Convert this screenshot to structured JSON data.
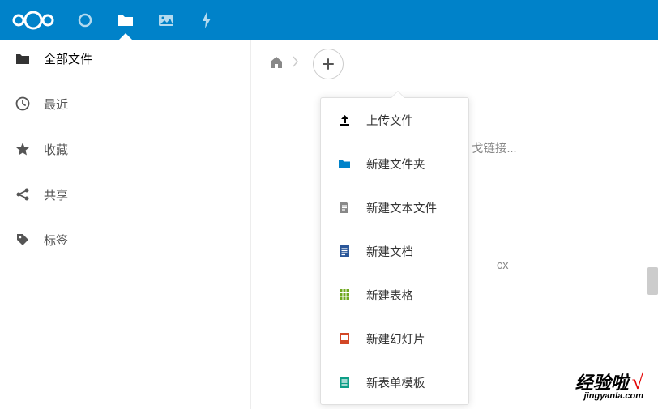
{
  "header": {
    "logo": "ooo",
    "navs": [
      {
        "name": "circle-icon"
      },
      {
        "name": "files-icon",
        "active": true
      },
      {
        "name": "gallery-icon"
      },
      {
        "name": "activity-icon"
      }
    ]
  },
  "sidebar": {
    "items": [
      {
        "icon": "folder-icon",
        "label": "全部文件",
        "active": true
      },
      {
        "icon": "clock-icon",
        "label": "最近"
      },
      {
        "icon": "star-icon",
        "label": "收藏"
      },
      {
        "icon": "share-icon",
        "label": "共享"
      },
      {
        "icon": "tag-icon",
        "label": "标签"
      }
    ]
  },
  "breadcrumb": {
    "home": "home-icon",
    "add": "+"
  },
  "dropdown": {
    "items": [
      {
        "icon": "upload-icon",
        "color": "#000000",
        "label": "上传文件"
      },
      {
        "icon": "folder-solid-icon",
        "color": "#0082c9",
        "label": "新建文件夹"
      },
      {
        "icon": "textfile-icon",
        "color": "#888888",
        "label": "新建文本文件"
      },
      {
        "icon": "doc-icon",
        "color": "#2a5699",
        "label": "新建文档"
      },
      {
        "icon": "sheet-icon",
        "color": "#6fa81f",
        "label": "新建表格"
      },
      {
        "icon": "slide-icon",
        "color": "#d24726",
        "label": "新建幻灯片"
      },
      {
        "icon": "form-icon",
        "color": "#0e9e87",
        "label": "新表单模板"
      }
    ]
  },
  "background": {
    "text1": "戈链接...",
    "text2": "cx"
  },
  "watermark": {
    "main": "经验啦",
    "check": "√",
    "sub": "jingyanla.com"
  }
}
